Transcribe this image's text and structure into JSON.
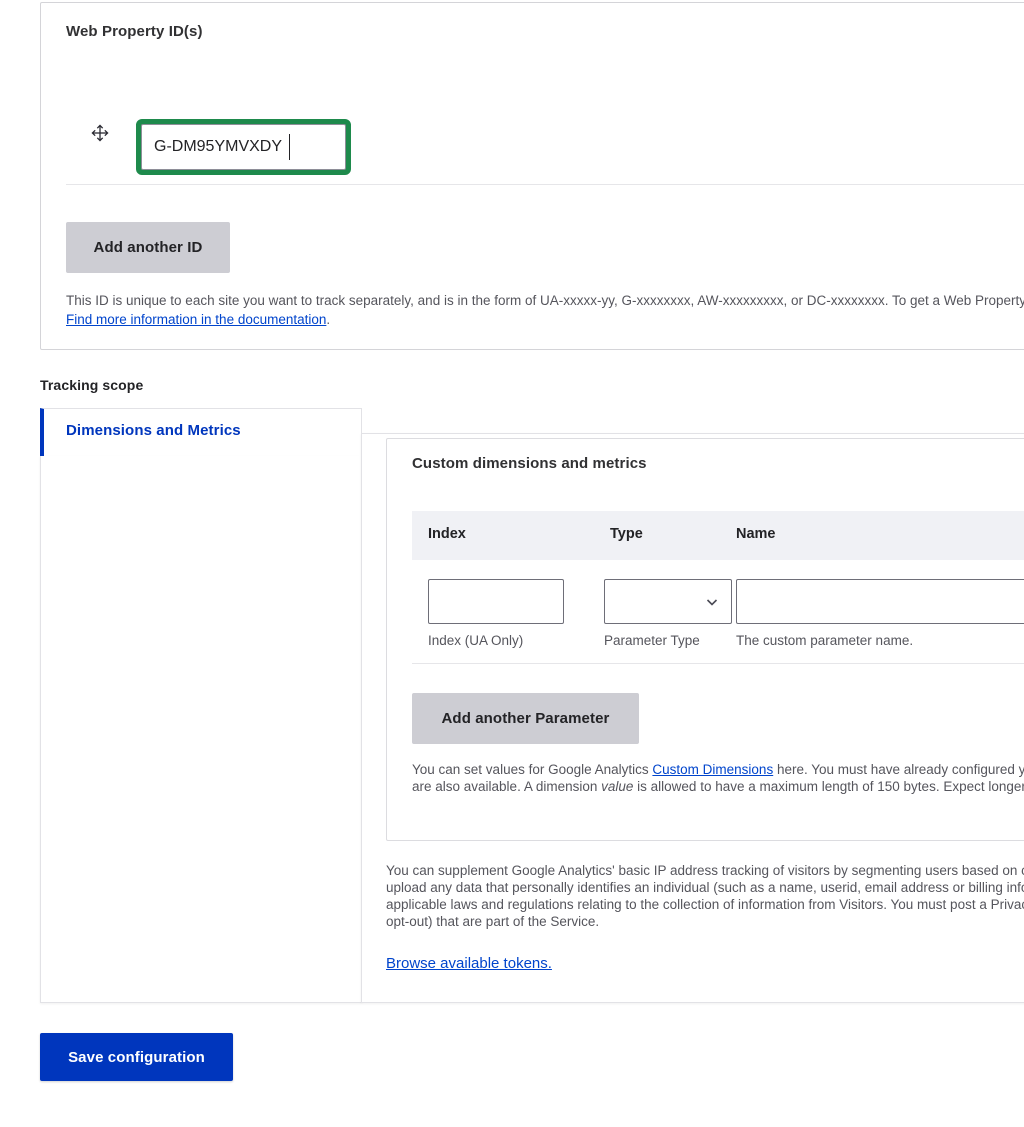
{
  "web_property": {
    "legend": "Web Property ID(s)",
    "drag_icon": "move-arrows-icon",
    "id_value": "G-DM95YMVXDY",
    "id_placeholder": "",
    "add_button": "Add another ID",
    "description_line1": "This ID is unique to each site you want to track separately, and is in the form of UA-xxxxx-yy, G-xxxxxxxx, AW-xxxxxxxxx, or DC-xxxxxxxx. To get a Web Property ID",
    "doc_link": "Find more information in the documentation",
    "doc_link_suffix": "."
  },
  "tracking_scope": {
    "label": "Tracking scope",
    "tabs": [
      {
        "label": "Dimensions and Metrics",
        "active": true
      }
    ]
  },
  "custom_dimensions": {
    "legend": "Custom dimensions and metrics",
    "table": {
      "headers": [
        "Index",
        "Type",
        "Name"
      ],
      "rows": [
        {
          "index_value": "",
          "index_hint": "Index (UA Only)",
          "type_value": "",
          "type_hint": "Parameter Type",
          "type_icon": "chevron-down-icon",
          "name_value": "",
          "name_hint": "The custom parameter name."
        }
      ]
    },
    "add_button": "Add another Parameter",
    "description_pre": "You can set values for Google Analytics ",
    "description_link": "Custom Dimensions",
    "description_post": " here. You must have already configured you",
    "description_line2_a": "are also available. A dimension ",
    "description_line2_italic": "value",
    "description_line2_b": " is allowed to have a maximum length of 150 bytes. Expect longer va"
  },
  "privacy_notice": {
    "line1": "You can supplement Google Analytics' basic IP address tracking of visitors by segmenting users based on cu",
    "line2": "upload any data that personally identifies an individual (such as a name, userid, email address or billing infor",
    "line3": "applicable laws and regulations relating to the collection of information from Visitors. You must post a Privac",
    "line4": "opt-out) that are part of the Service.",
    "tokens_link": "Browse available tokens."
  },
  "actions": {
    "save_label": "Save configuration"
  },
  "colors": {
    "accent_blue": "#0036bd",
    "link_blue": "#0044cc",
    "focus_green": "#1e8a4c",
    "button_grey": "#cdcdd3",
    "table_header_bg": "#f0f1f5"
  }
}
